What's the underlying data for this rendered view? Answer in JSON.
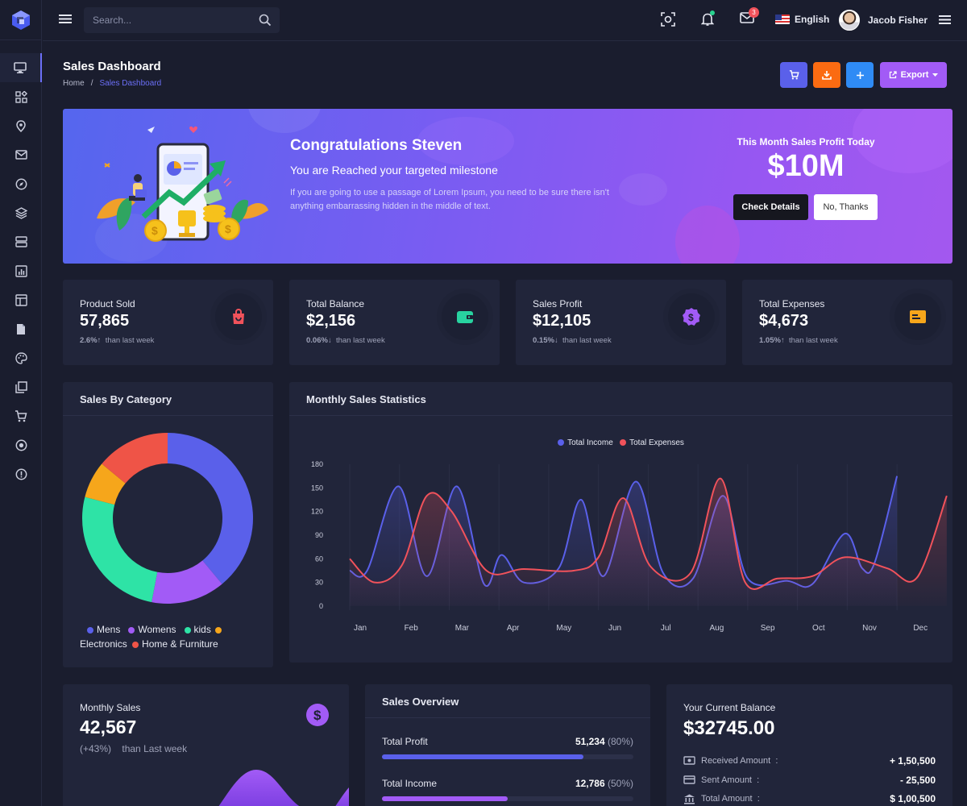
{
  "topbar": {
    "search_placeholder": "Search...",
    "notification_count": "",
    "mail_count": "3",
    "language": "English",
    "user_name": "Jacob Fisher"
  },
  "page": {
    "title": "Sales Dashboard",
    "breadcrumb": [
      "Home",
      "/",
      "Sales Dashboard"
    ],
    "export_label": "Export"
  },
  "banner": {
    "title": "Congratulations Steven",
    "subtitle": "You are Reached your targeted milestone",
    "text": "If you are going to use a passage of Lorem Ipsum, you need to be sure there isn't anything embarrassing hidden in the middle of text.",
    "right_label": "This Month Sales Profit Today",
    "amount": "$10M",
    "check_btn": "Check Details",
    "no_btn": "No, Thanks"
  },
  "stats": [
    {
      "label": "Product Sold",
      "value": "57,865",
      "pct": "2.6%",
      "arrow": "↑",
      "foot": "than last week",
      "icon": "shopping-bag-icon",
      "color": "#f1525b"
    },
    {
      "label": "Total Balance",
      "value": "$2,156",
      "pct": "0.06%",
      "arrow": "↓",
      "foot": "than last week",
      "icon": "wallet-icon",
      "color": "#28d3a0"
    },
    {
      "label": "Sales Profit",
      "value": "$12,105",
      "pct": "0.15%",
      "arrow": "↓",
      "foot": "than last week",
      "icon": "dollar-badge-icon",
      "color": "#a25bf6"
    },
    {
      "label": "Total Expenses",
      "value": "$4,673",
      "pct": "1.05%",
      "arrow": "↑",
      "foot": "than last week",
      "icon": "card-icon",
      "color": "#f6a61b"
    }
  ],
  "category": {
    "title": "Sales By Category",
    "legend": [
      {
        "name": "Mens",
        "color": "#5a60ea"
      },
      {
        "name": "Womens",
        "color": "#a25bf6"
      },
      {
        "name": "kids",
        "color": "#2ee3a6"
      },
      {
        "name": "Electronics",
        "color": "#f6a61b"
      },
      {
        "name": "Home & Furniture",
        "color": "#ef5447"
      }
    ]
  },
  "monthly_stats": {
    "title": "Monthly Sales Statistics",
    "legend": [
      {
        "name": "Total Income",
        "color": "#5a60ea"
      },
      {
        "name": "Total Expenses",
        "color": "#f1525b"
      }
    ]
  },
  "monthly_sales": {
    "label": "Monthly Sales",
    "value": "42,567",
    "pct": "(+43%)",
    "foot": "than Last week"
  },
  "overview": {
    "title": "Sales Overview",
    "rows": [
      {
        "label": "Total Profit",
        "value": "51,234",
        "pct": "(80%)",
        "fill": 0.8,
        "color": "#5a60ea"
      },
      {
        "label": "Total Income",
        "value": "12,786",
        "pct": "(50%)",
        "fill": 0.5,
        "color": "#a25bf6"
      }
    ]
  },
  "balance": {
    "label": "Your Current Balance",
    "value": "$32745.00",
    "rows": [
      {
        "label": "Received Amount",
        "sep": ":",
        "amount": "+ 1,50,500",
        "icon": "money-icon"
      },
      {
        "label": "Sent Amount",
        "sep": ":",
        "amount": "- 25,500",
        "icon": "credit-card-icon"
      },
      {
        "label": "Total Amount",
        "sep": ":",
        "amount": "$ 1,00,500",
        "icon": "bank-icon"
      }
    ]
  },
  "chart_data": [
    {
      "type": "pie",
      "title": "Sales By Category",
      "categories": [
        "Mens",
        "Womens",
        "kids",
        "Electronics",
        "Home & Furniture"
      ],
      "values": [
        39,
        14,
        26,
        7,
        14
      ],
      "colors": [
        "#5a60ea",
        "#a25bf6",
        "#2ee3a6",
        "#f6a61b",
        "#ef5447"
      ],
      "donut": true
    },
    {
      "type": "line",
      "title": "Monthly Sales Statistics",
      "x": [
        "Jan",
        "Feb",
        "Mar",
        "Apr",
        "May",
        "Jun",
        "Jul",
        "Aug",
        "Sep",
        "Oct",
        "Nov",
        "Dec"
      ],
      "ylim": [
        0,
        180
      ],
      "yticks": [
        0,
        30,
        60,
        90,
        120,
        150,
        180
      ],
      "series": [
        {
          "name": "Total Income",
          "color": "#5a60ea",
          "points": [
            [
              0,
              45
            ],
            [
              0.35,
              45
            ],
            [
              0.98,
              152
            ],
            [
              1.55,
              38
            ],
            [
              2.15,
              152
            ],
            [
              2.7,
              28
            ],
            [
              3.05,
              65
            ],
            [
              3.5,
              30
            ],
            [
              4.2,
              48
            ],
            [
              4.65,
              135
            ],
            [
              5.1,
              38
            ],
            [
              5.75,
              158
            ],
            [
              6.3,
              42
            ],
            [
              6.9,
              35
            ],
            [
              7.5,
              140
            ],
            [
              8.0,
              35
            ],
            [
              8.8,
              32
            ],
            [
              9.3,
              28
            ],
            [
              9.95,
              92
            ],
            [
              10.3,
              48
            ],
            [
              10.55,
              55
            ],
            [
              11.0,
              165
            ]
          ]
        },
        {
          "name": "Total Expenses",
          "color": "#f1525b",
          "points": [
            [
              0,
              60
            ],
            [
              0.5,
              30
            ],
            [
              1.05,
              52
            ],
            [
              1.55,
              140
            ],
            [
              2.05,
              120
            ],
            [
              2.75,
              45
            ],
            [
              3.5,
              47
            ],
            [
              4.5,
              45
            ],
            [
              5.0,
              62
            ],
            [
              5.5,
              137
            ],
            [
              6.05,
              50
            ],
            [
              6.85,
              42
            ],
            [
              7.45,
              162
            ],
            [
              7.95,
              30
            ],
            [
              8.6,
              35
            ],
            [
              9.3,
              38
            ],
            [
              9.95,
              62
            ],
            [
              10.8,
              48
            ],
            [
              11.4,
              36
            ],
            [
              12.0,
              140
            ]
          ]
        }
      ]
    },
    {
      "type": "area",
      "title": "Monthly Sales",
      "color": "#a25bf6"
    }
  ]
}
